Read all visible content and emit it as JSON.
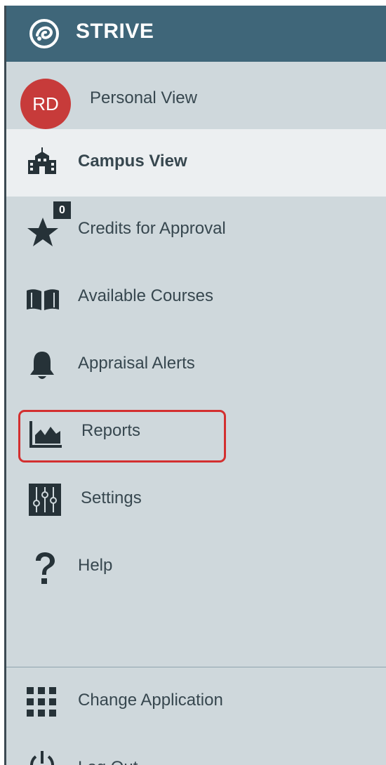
{
  "app": {
    "name": "STRIVE"
  },
  "colors": {
    "header": "#3f6679",
    "sidebar": "#cfd8dc",
    "active": "#eceff1",
    "avatar": "#c73b3a",
    "highlight": "#d32f2f",
    "icon": "#263238"
  },
  "user": {
    "initials": "RD",
    "view_label": "Personal View"
  },
  "nav": [
    {
      "label": "Campus View",
      "icon": "school-icon",
      "active": true
    },
    {
      "label": "Credits for Approval",
      "icon": "star-icon",
      "badge": "0"
    },
    {
      "label": "Available Courses",
      "icon": "book-icon"
    },
    {
      "label": "Appraisal Alerts",
      "icon": "bell-icon"
    },
    {
      "label": "Reports",
      "icon": "area-chart-icon",
      "highlighted": true
    },
    {
      "label": "Settings",
      "icon": "sliders-icon"
    },
    {
      "label": "Help",
      "icon": "question-icon"
    }
  ],
  "footer": [
    {
      "label": "Change Application",
      "icon": "grid-icon"
    },
    {
      "label": "Log Out",
      "icon": "power-icon"
    }
  ]
}
